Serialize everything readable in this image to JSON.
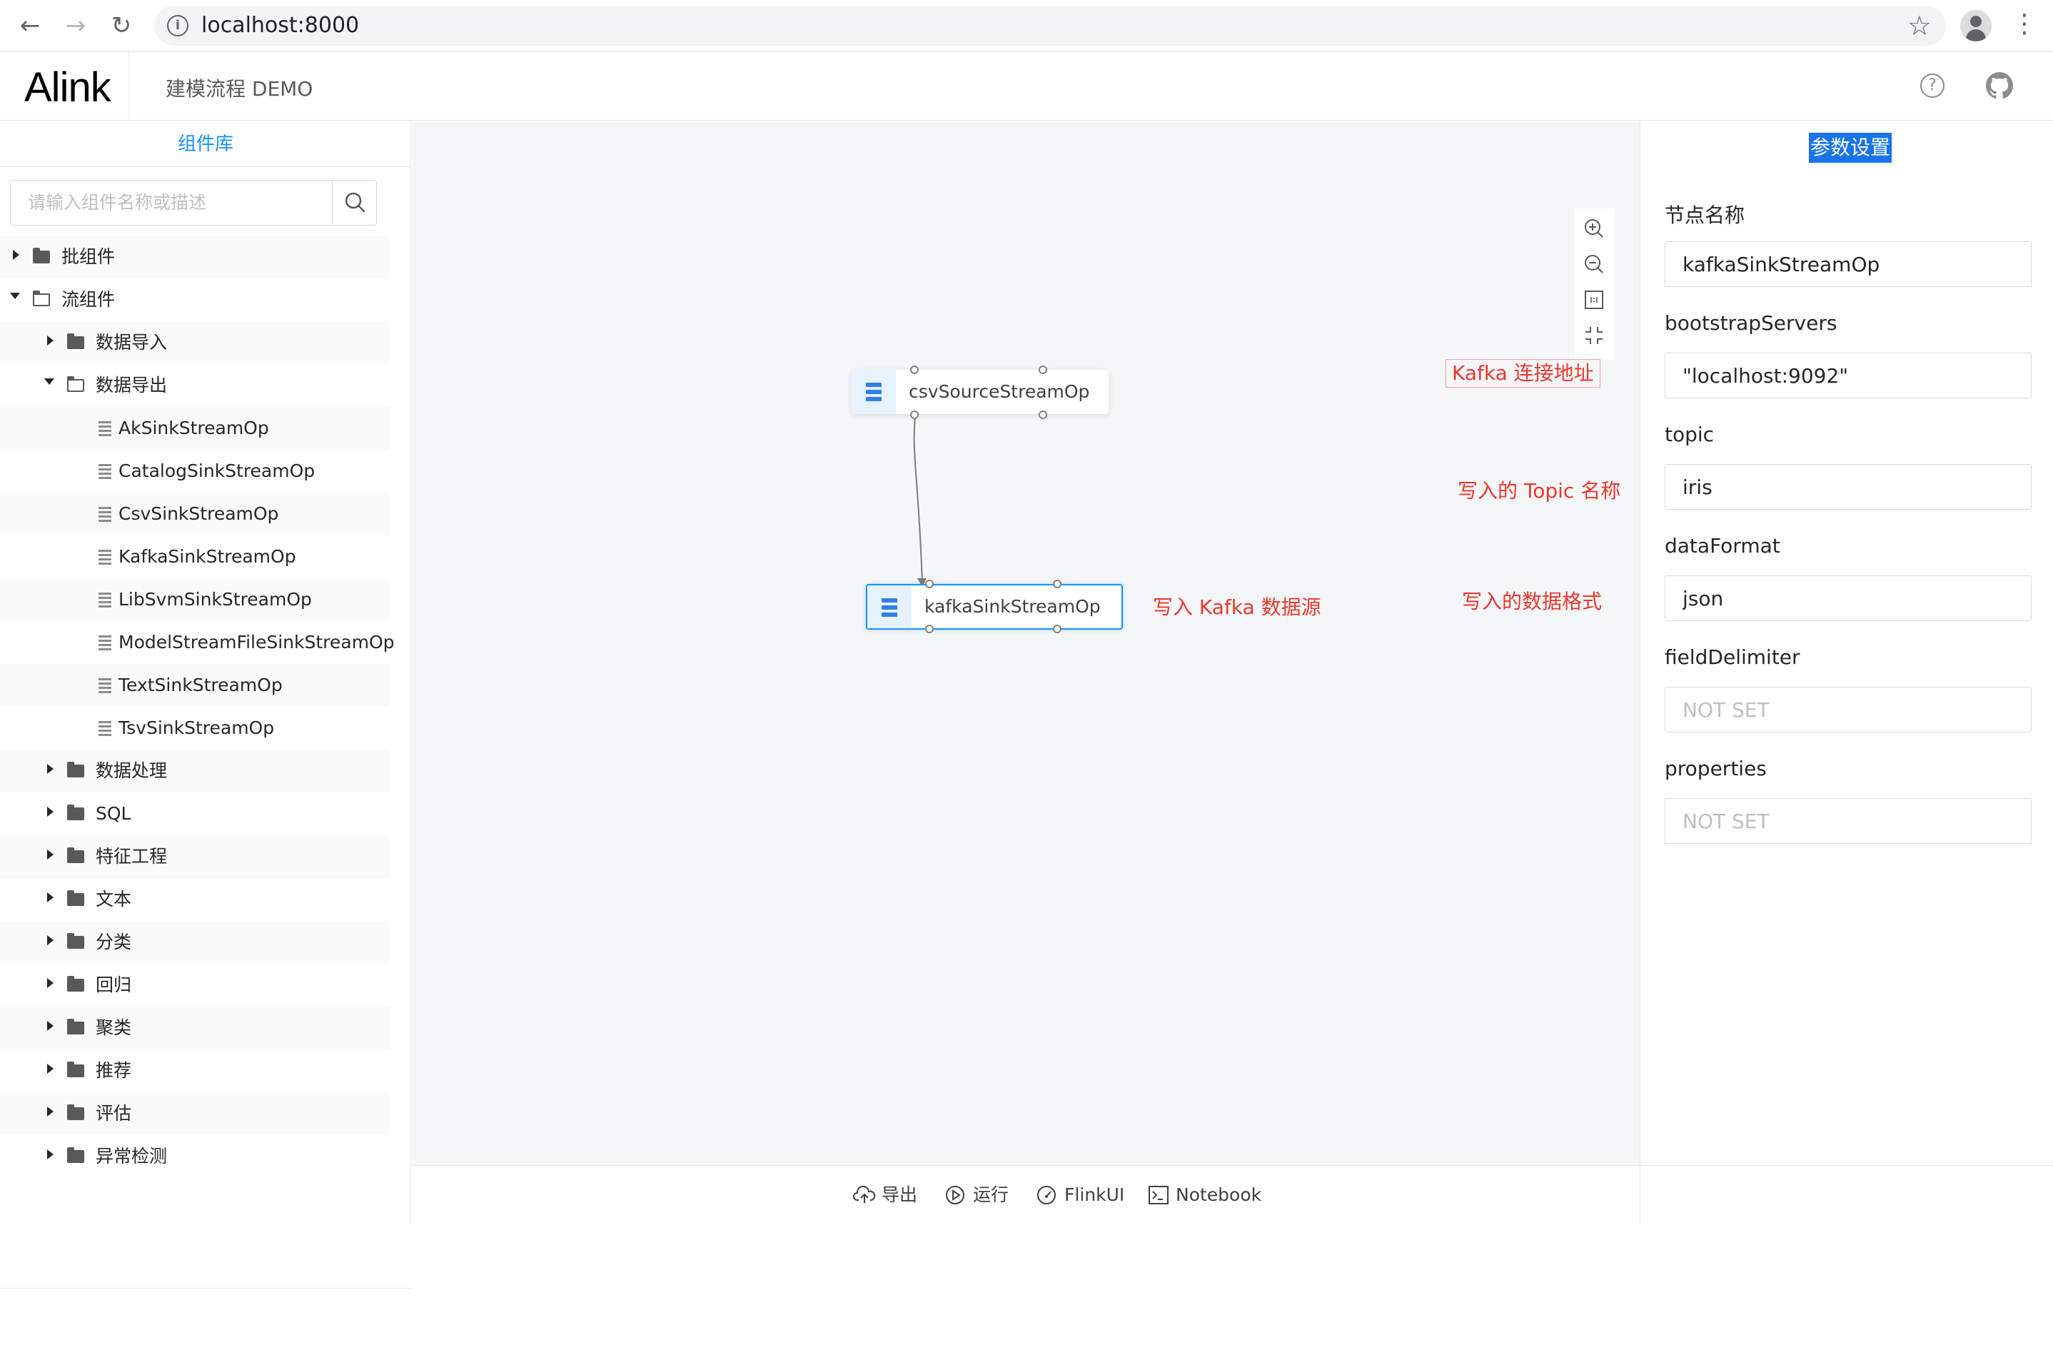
{
  "browser": {
    "url": "localhost:8000",
    "back_icon": "←",
    "forward_icon": "→",
    "reload_icon": "↻",
    "star_icon": "☆",
    "menu_icon": "⋮",
    "info_icon": "i"
  },
  "header": {
    "logo": "Alink",
    "subtitle": "建模流程 DEMO",
    "help_icon": "?"
  },
  "sidebar": {
    "title": "组件库",
    "search_placeholder": "请输入组件名称或描述",
    "tree": [
      {
        "label": "批组件",
        "level": 0,
        "expanded": false,
        "type": "folder"
      },
      {
        "label": "流组件",
        "level": 0,
        "expanded": true,
        "type": "folder"
      },
      {
        "label": "数据导入",
        "level": 1,
        "expanded": false,
        "type": "folder"
      },
      {
        "label": "数据导出",
        "level": 1,
        "expanded": true,
        "type": "folder"
      },
      {
        "label": "AkSinkStreamOp",
        "level": 2,
        "type": "leaf"
      },
      {
        "label": "CatalogSinkStreamOp",
        "level": 2,
        "type": "leaf"
      },
      {
        "label": "CsvSinkStreamOp",
        "level": 2,
        "type": "leaf"
      },
      {
        "label": "KafkaSinkStreamOp",
        "level": 2,
        "type": "leaf"
      },
      {
        "label": "LibSvmSinkStreamOp",
        "level": 2,
        "type": "leaf"
      },
      {
        "label": "ModelStreamFileSinkStreamOp",
        "level": 2,
        "type": "leaf"
      },
      {
        "label": "TextSinkStreamOp",
        "level": 2,
        "type": "leaf"
      },
      {
        "label": "TsvSinkStreamOp",
        "level": 2,
        "type": "leaf"
      },
      {
        "label": "数据处理",
        "level": 1,
        "expanded": false,
        "type": "folder"
      },
      {
        "label": "SQL",
        "level": 1,
        "expanded": false,
        "type": "folder"
      },
      {
        "label": "特征工程",
        "level": 1,
        "expanded": false,
        "type": "folder"
      },
      {
        "label": "文本",
        "level": 1,
        "expanded": false,
        "type": "folder"
      },
      {
        "label": "分类",
        "level": 1,
        "expanded": false,
        "type": "folder"
      },
      {
        "label": "回归",
        "level": 1,
        "expanded": false,
        "type": "folder"
      },
      {
        "label": "聚类",
        "level": 1,
        "expanded": false,
        "type": "folder"
      },
      {
        "label": "推荐",
        "level": 1,
        "expanded": false,
        "type": "folder"
      },
      {
        "label": "评估",
        "level": 1,
        "expanded": false,
        "type": "folder"
      },
      {
        "label": "异常检测",
        "level": 1,
        "expanded": false,
        "type": "folder"
      }
    ]
  },
  "canvas": {
    "nodes": {
      "source": "csvSourceStreamOp",
      "sink": "kafkaSinkStreamOp"
    },
    "annotations": {
      "kafka_address": "Kafka 连接地址",
      "topic_name": "写入的 Topic 名称",
      "data_format": "写入的数据格式",
      "write_kafka": "写入 Kafka 数据源"
    },
    "annotation_color": "#e8382c",
    "zoom_tools": [
      "zoom-in-icon",
      "zoom-out-icon",
      "fit-view-icon",
      "collapse-icon"
    ]
  },
  "bottom_bar": {
    "export": "导出",
    "run": "运行",
    "flinkui": "FlinkUI",
    "notebook": "Notebook"
  },
  "params": {
    "title": "参数设置",
    "fields": [
      {
        "label": "节点名称",
        "value": "kafkaSinkStreamOp",
        "placeholder": ""
      },
      {
        "label": "bootstrapServers",
        "value": "\"localhost:9092\"",
        "placeholder": ""
      },
      {
        "label": "topic",
        "value": "iris",
        "placeholder": ""
      },
      {
        "label": "dataFormat",
        "value": "json",
        "placeholder": ""
      },
      {
        "label": "fieldDelimiter",
        "value": "",
        "placeholder": "NOT SET"
      },
      {
        "label": "properties",
        "value": "",
        "placeholder": "NOT SET"
      }
    ]
  },
  "colors": {
    "accent": "#1890ff",
    "selection": "#1a73e8",
    "node_icon": "#2f7fe8"
  }
}
